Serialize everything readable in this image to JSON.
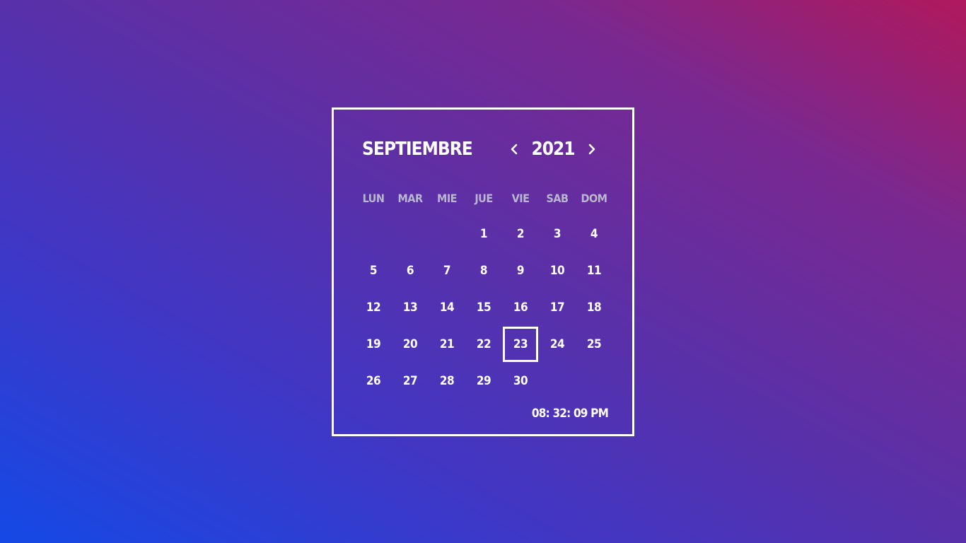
{
  "calendar": {
    "month": "SEPTIEMBRE",
    "year": "2021",
    "prev_icon": "chevron-left-icon",
    "next_icon": "chevron-right-icon",
    "weekdays": [
      "LUN",
      "MAR",
      "MIE",
      "JUE",
      "VIE",
      "SAB",
      "DOM"
    ],
    "days": [
      [
        "",
        "",
        "",
        "1",
        "2",
        "3",
        "4"
      ],
      [
        "5",
        "6",
        "7",
        "8",
        "9",
        "10",
        "11"
      ],
      [
        "12",
        "13",
        "14",
        "15",
        "16",
        "17",
        "18"
      ],
      [
        "19",
        "20",
        "21",
        "22",
        "23",
        "24",
        "25"
      ],
      [
        "26",
        "27",
        "28",
        "29",
        "30",
        "",
        ""
      ]
    ],
    "selected_day": "23",
    "clock": "08: 32: 09 PM"
  },
  "colors": {
    "gradient_start": "#1449e6",
    "gradient_end": "#b0195c",
    "text": "#ffffff",
    "weekday_text": "#b9b6cf"
  }
}
